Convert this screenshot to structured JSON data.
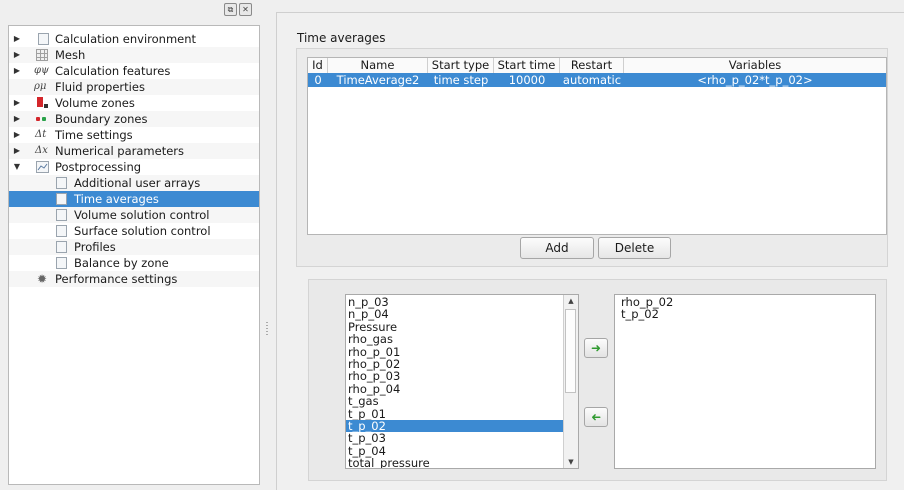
{
  "tree": {
    "items": [
      {
        "label": "Calculation environment",
        "icon": "doc-icon"
      },
      {
        "label": "Mesh",
        "icon": "grid-icon"
      },
      {
        "label": "Calculation features",
        "icon": "phi-psi-icon",
        "glyph": "φψ"
      },
      {
        "label": "Fluid properties",
        "icon": "rho-mu-icon",
        "glyph": "ρμ"
      },
      {
        "label": "Volume zones",
        "icon": "volume-zones-icon"
      },
      {
        "label": "Boundary zones",
        "icon": "boundary-zones-icon"
      },
      {
        "label": "Time settings",
        "icon": "delta-t-icon",
        "glyph": "Δt"
      },
      {
        "label": "Numerical parameters",
        "icon": "delta-x-icon",
        "glyph": "Δx"
      },
      {
        "label": "Postprocessing",
        "icon": "chart-icon"
      },
      {
        "label": "Additional user arrays",
        "icon": "doc-icon"
      },
      {
        "label": "Time averages",
        "icon": "doc-icon"
      },
      {
        "label": "Volume solution control",
        "icon": "doc-icon"
      },
      {
        "label": "Surface solution control",
        "icon": "doc-icon"
      },
      {
        "label": "Profiles",
        "icon": "doc-icon"
      },
      {
        "label": "Balance by zone",
        "icon": "doc-icon"
      },
      {
        "label": "Performance settings",
        "icon": "gear-icon"
      }
    ]
  },
  "panel": {
    "title": "Time averages",
    "table": {
      "headers": [
        "Id",
        "Name",
        "Start type",
        "Start time",
        "Restart",
        "Variables"
      ],
      "rows": [
        [
          "0",
          "TimeAverage2",
          "time step",
          "10000",
          "automatic",
          "<rho_p_02*t_p_02>"
        ]
      ]
    },
    "add_label": "Add",
    "delete_label": "Delete",
    "available": [
      "n_p_03",
      "n_p_04",
      "Pressure",
      "rho_gas",
      "rho_p_01",
      "rho_p_02",
      "rho_p_03",
      "rho_p_04",
      "t_gas",
      "t_p_01",
      "t_p_02",
      "t_p_03",
      "t_p_04",
      "total_pressure"
    ],
    "available_selected": "t_p_02",
    "selected": [
      "rho_p_02",
      "t_p_02"
    ]
  },
  "colors": {
    "selection": "#3c8ad2",
    "arrow_green": "#2f9a2f"
  }
}
